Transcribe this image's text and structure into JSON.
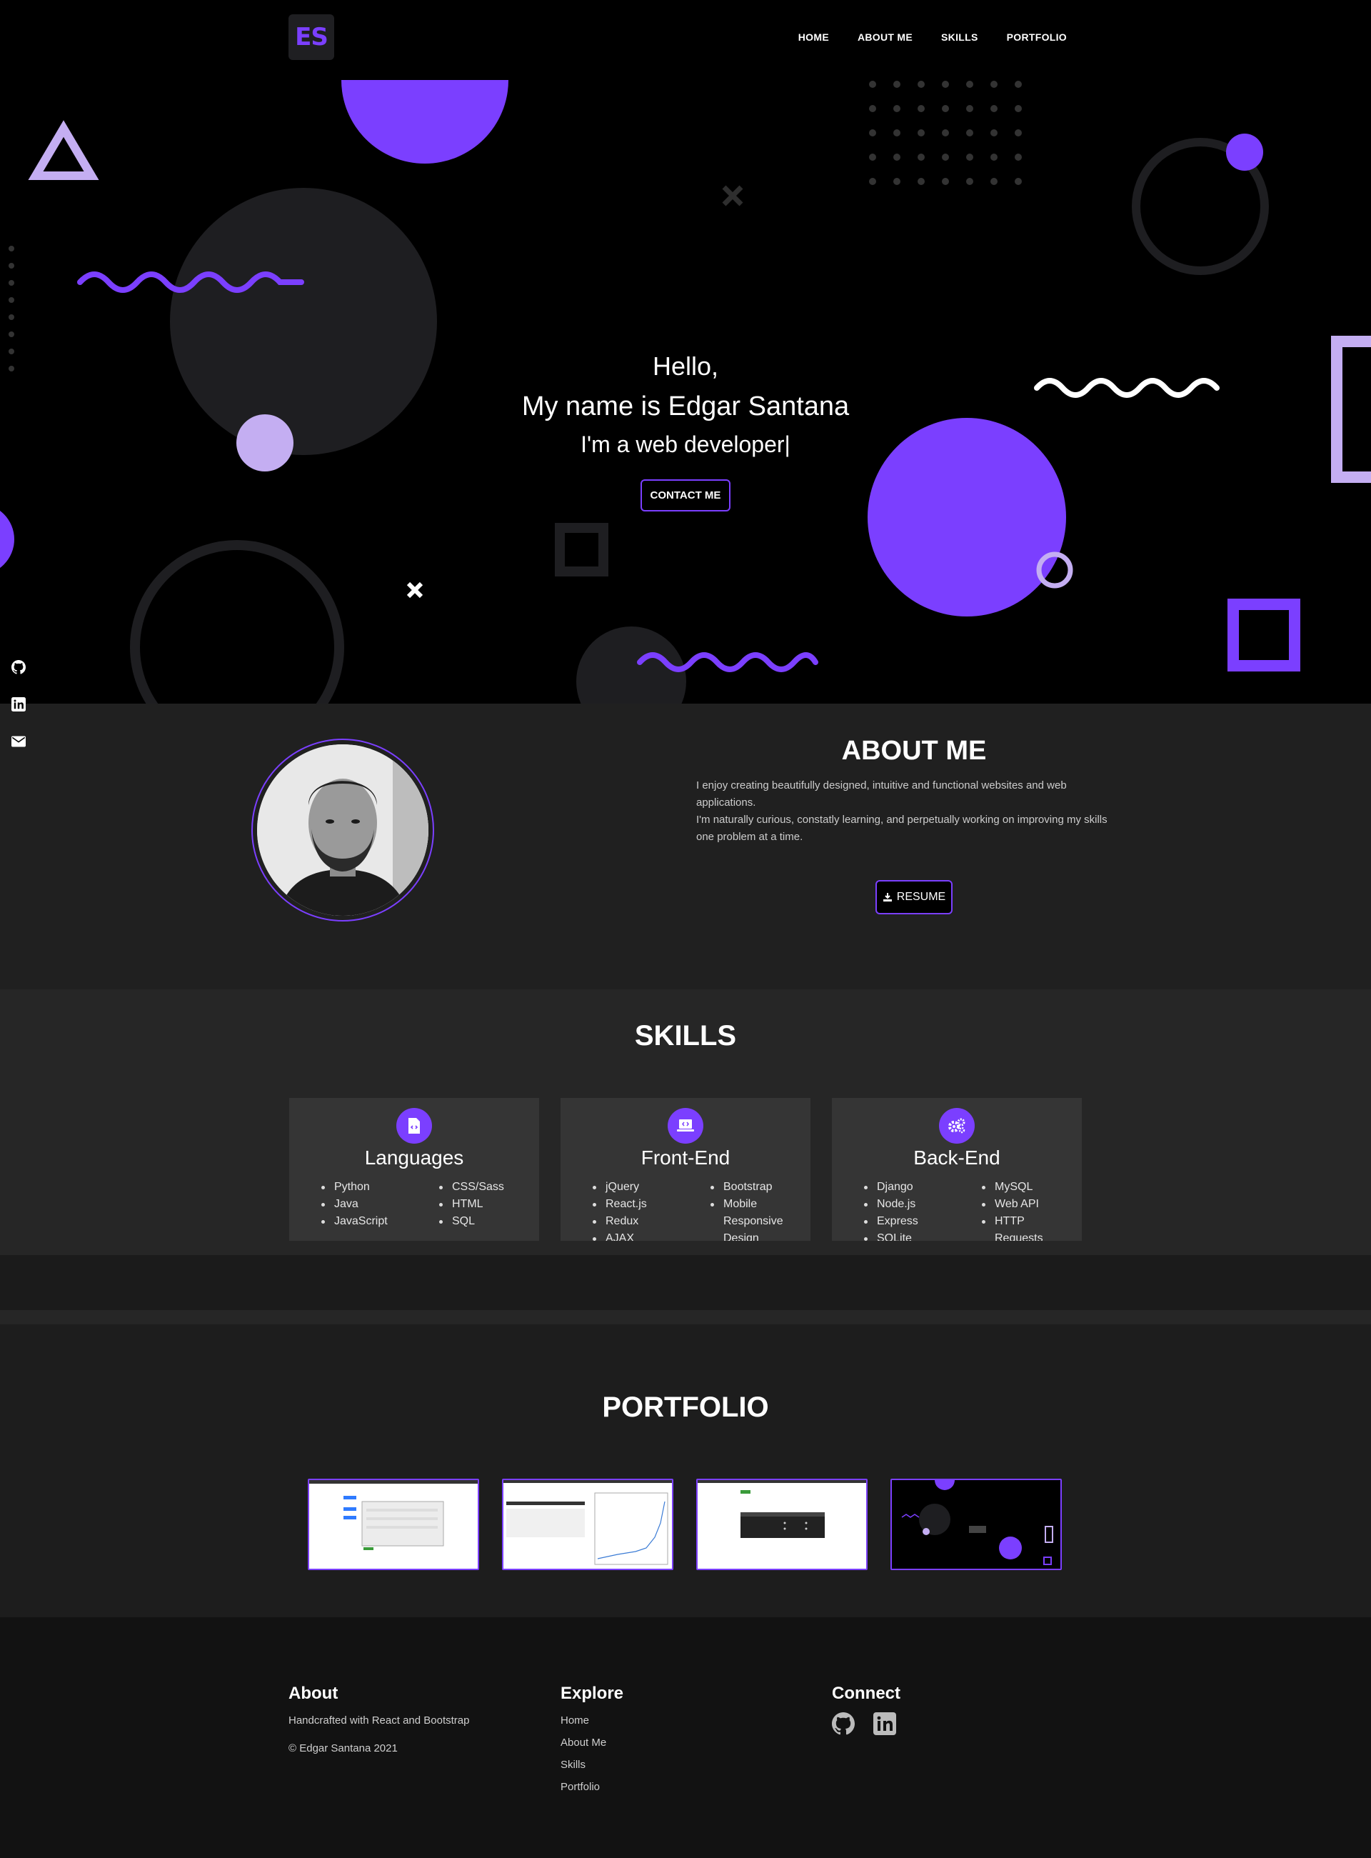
{
  "nav": {
    "logo": "ES",
    "links": [
      "HOME",
      "ABOUT ME",
      "SKILLS",
      "PORTFOLIO"
    ]
  },
  "hero": {
    "hello": "Hello,",
    "name": "My name is Edgar Santana",
    "role": "I'm a web developer|",
    "cta": "CONTACT ME"
  },
  "social": {
    "icons": [
      "github-icon",
      "linkedin-icon",
      "email-icon"
    ]
  },
  "about": {
    "title": "ABOUT ME",
    "paragraph1": "I enjoy creating beautifully designed, intuitive and functional websites and web applications.",
    "paragraph2": "I'm naturally curious, constatly learning, and perpetually working on improving my skills one problem at a time.",
    "resume": "RESUME"
  },
  "skills": {
    "title": "SKILLS",
    "cards": [
      {
        "name": "Languages",
        "col1": [
          "Python",
          "Java",
          "JavaScript"
        ],
        "col2": [
          "CSS/Sass",
          "HTML",
          "SQL"
        ]
      },
      {
        "name": "Front-End",
        "col1": [
          "jQuery",
          "React.js",
          "Redux",
          "AJAX"
        ],
        "col2": [
          "Bootstrap",
          "Mobile Responsive Design"
        ]
      },
      {
        "name": "Back-End",
        "col1": [
          "Django",
          "Node.js",
          "Express",
          "SQLite"
        ],
        "col2": [
          "MySQL",
          "Web API",
          "HTTP Requests"
        ]
      }
    ]
  },
  "portfolio": {
    "title": "PORTFOLIO"
  },
  "footer": {
    "about_title": "About",
    "about_text": "Handcrafted with React and Bootstrap",
    "copyright": "© Edgar Santana 2021",
    "explore_title": "Explore",
    "explore_links": [
      "Home",
      "About Me",
      "Skills",
      "Portfolio"
    ],
    "connect_title": "Connect"
  },
  "colors": {
    "accent": "#7b3fff",
    "accent_light": "#c4aef2",
    "hero_bg": "#000000",
    "about_bg": "#202020",
    "skills_bg": "#262626",
    "card_bg": "#353535",
    "footer_bg": "#121212"
  }
}
